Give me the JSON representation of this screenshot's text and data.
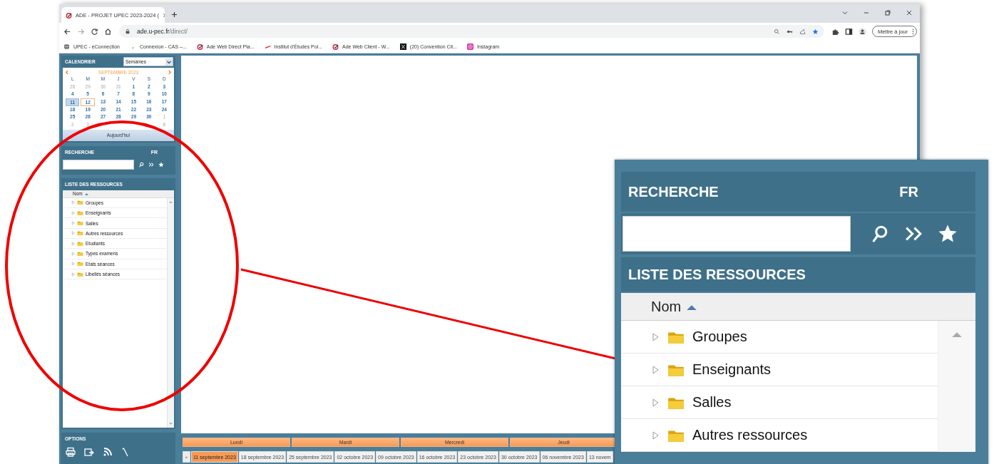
{
  "browser": {
    "tab": {
      "title": "ADE - PROJET UPEC 2023-2024 (",
      "selected": true
    },
    "address": {
      "domain": "ade.u-pec.fr",
      "path": "/direct/"
    },
    "update_button": "Mettre à jour",
    "bookmarks": [
      {
        "label": "UPEC - eConnection",
        "kind": "globe"
      },
      {
        "label": "Connexion - CAS –...",
        "kind": "leaf"
      },
      {
        "label": "Ade Web Direct Pla...",
        "kind": "ade"
      },
      {
        "label": "Institut d'Études Pol...",
        "kind": "dash"
      },
      {
        "label": "Ade Web Client - W...",
        "kind": "ade"
      },
      {
        "label": "(20) Convention Cit...",
        "kind": "x"
      },
      {
        "label": "Instagram",
        "kind": "insta"
      }
    ]
  },
  "calendar": {
    "title": "CALENDRIER",
    "view": "Semaines",
    "month": "SEPTEMBRE 2023",
    "weekdays": [
      "L",
      "M",
      "M",
      "J",
      "V",
      "S",
      "D"
    ],
    "weeks": [
      [
        {
          "day": "28",
          "muted": true,
          "selected": false,
          "today": false
        },
        {
          "day": "29",
          "muted": true,
          "selected": false,
          "today": false
        },
        {
          "day": "30",
          "muted": true,
          "selected": false,
          "today": false
        },
        {
          "day": "31",
          "muted": true,
          "selected": false,
          "today": false
        },
        {
          "day": "1",
          "muted": false,
          "selected": false,
          "today": false
        },
        {
          "day": "2",
          "muted": false,
          "selected": false,
          "today": false
        },
        {
          "day": "3",
          "muted": false,
          "selected": false,
          "today": false
        }
      ],
      [
        {
          "day": "4",
          "muted": false,
          "selected": false,
          "today": false
        },
        {
          "day": "5",
          "muted": false,
          "selected": false,
          "today": false
        },
        {
          "day": "6",
          "muted": false,
          "selected": false,
          "today": false
        },
        {
          "day": "7",
          "muted": false,
          "selected": false,
          "today": false
        },
        {
          "day": "8",
          "muted": false,
          "selected": false,
          "today": false
        },
        {
          "day": "9",
          "muted": false,
          "selected": false,
          "today": false
        },
        {
          "day": "10",
          "muted": false,
          "selected": false,
          "today": false
        }
      ],
      [
        {
          "day": "11",
          "muted": false,
          "selected": true,
          "today": false
        },
        {
          "day": "12",
          "muted": false,
          "selected": false,
          "today": true
        },
        {
          "day": "13",
          "muted": false,
          "selected": false,
          "today": false
        },
        {
          "day": "14",
          "muted": false,
          "selected": false,
          "today": false
        },
        {
          "day": "15",
          "muted": false,
          "selected": false,
          "today": false
        },
        {
          "day": "16",
          "muted": false,
          "selected": false,
          "today": false
        },
        {
          "day": "17",
          "muted": false,
          "selected": false,
          "today": false
        }
      ],
      [
        {
          "day": "18",
          "muted": false,
          "selected": false,
          "today": false
        },
        {
          "day": "19",
          "muted": false,
          "selected": false,
          "today": false
        },
        {
          "day": "20",
          "muted": false,
          "selected": false,
          "today": false
        },
        {
          "day": "21",
          "muted": false,
          "selected": false,
          "today": false
        },
        {
          "day": "22",
          "muted": false,
          "selected": false,
          "today": false
        },
        {
          "day": "23",
          "muted": false,
          "selected": false,
          "today": false
        },
        {
          "day": "24",
          "muted": false,
          "selected": false,
          "today": false
        }
      ],
      [
        {
          "day": "25",
          "muted": false,
          "selected": false,
          "today": false
        },
        {
          "day": "26",
          "muted": false,
          "selected": false,
          "today": false
        },
        {
          "day": "27",
          "muted": false,
          "selected": false,
          "today": false
        },
        {
          "day": "28",
          "muted": false,
          "selected": false,
          "today": false
        },
        {
          "day": "29",
          "muted": false,
          "selected": false,
          "today": false
        },
        {
          "day": "30",
          "muted": false,
          "selected": false,
          "today": false
        },
        {
          "day": "1",
          "muted": true,
          "selected": false,
          "today": false
        }
      ],
      [
        {
          "day": "2",
          "muted": true,
          "selected": false,
          "today": false
        },
        {
          "day": "3",
          "muted": true,
          "selected": false,
          "today": false
        },
        {
          "covered": true
        },
        {
          "covered": true
        },
        {
          "covered": true
        },
        {
          "covered": true
        },
        {
          "day": "8",
          "muted": true,
          "selected": false,
          "today": false
        }
      ]
    ],
    "today_button": "Aujourd'hui"
  },
  "search": {
    "title": "RECHERCHE",
    "language": "FR"
  },
  "resources": {
    "title": "LISTE DES RESSOURCES",
    "column": "Nom",
    "items": [
      {
        "label": "Groupes",
        "expanded": false
      },
      {
        "label": "Enseignants",
        "expanded": false
      },
      {
        "label": "Salles",
        "expanded": false
      },
      {
        "label": "Autres ressources",
        "expanded": false
      },
      {
        "label": "Etudiants",
        "expanded": false
      },
      {
        "label": "Types examens",
        "expanded": false
      },
      {
        "label": "Etats séances",
        "expanded": false
      },
      {
        "label": "Libellés séances",
        "expanded": false
      }
    ]
  },
  "options": {
    "title": "OPTIONS"
  },
  "timeline": {
    "prev": "«",
    "days": [
      "Lundi",
      "Mardi",
      "Mercredi",
      "Jeudi"
    ],
    "weeks": [
      {
        "label": "11 septembre 2023",
        "selected": true
      },
      {
        "label": "18 septembre 2023",
        "selected": false
      },
      {
        "label": "25 septembre 2023",
        "selected": false
      },
      {
        "label": "02 octobre 2023",
        "selected": false
      },
      {
        "label": "09 octobre 2023",
        "selected": false
      },
      {
        "label": "16 octobre 2023",
        "selected": false
      },
      {
        "label": "23 octobre 2023",
        "selected": false
      },
      {
        "label": "30 octobre 2023",
        "selected": false
      },
      {
        "label": "06 novembre 2023",
        "selected": false
      },
      {
        "label": "13 novem",
        "selected": false
      }
    ]
  },
  "inset": {
    "search_title": "RECHERCHE",
    "language": "FR",
    "list_title": "LISTE DES RESSOURCES",
    "column": "Nom",
    "items": [
      {
        "label": "Groupes",
        "expanded": false
      },
      {
        "label": "Enseignants",
        "expanded": false
      },
      {
        "label": "Salles",
        "expanded": false
      },
      {
        "label": "Autres ressources",
        "expanded": false
      }
    ]
  }
}
